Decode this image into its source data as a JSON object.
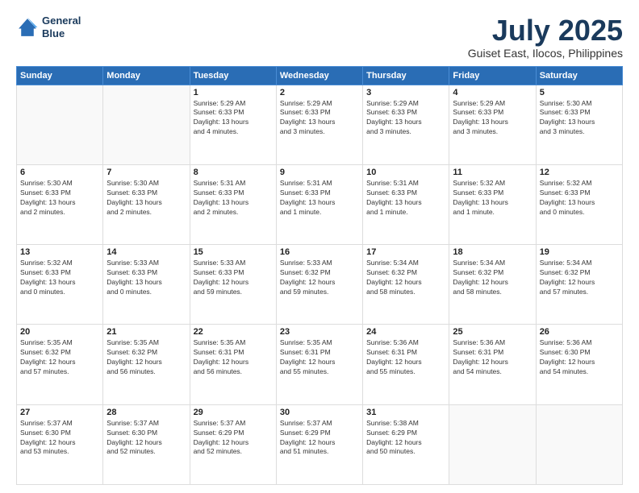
{
  "logo": {
    "line1": "General",
    "line2": "Blue"
  },
  "title": "July 2025",
  "subtitle": "Guiset East, Ilocos, Philippines",
  "weekdays": [
    "Sunday",
    "Monday",
    "Tuesday",
    "Wednesday",
    "Thursday",
    "Friday",
    "Saturday"
  ],
  "weeks": [
    [
      {
        "day": "",
        "info": ""
      },
      {
        "day": "",
        "info": ""
      },
      {
        "day": "1",
        "info": "Sunrise: 5:29 AM\nSunset: 6:33 PM\nDaylight: 13 hours\nand 4 minutes."
      },
      {
        "day": "2",
        "info": "Sunrise: 5:29 AM\nSunset: 6:33 PM\nDaylight: 13 hours\nand 3 minutes."
      },
      {
        "day": "3",
        "info": "Sunrise: 5:29 AM\nSunset: 6:33 PM\nDaylight: 13 hours\nand 3 minutes."
      },
      {
        "day": "4",
        "info": "Sunrise: 5:29 AM\nSunset: 6:33 PM\nDaylight: 13 hours\nand 3 minutes."
      },
      {
        "day": "5",
        "info": "Sunrise: 5:30 AM\nSunset: 6:33 PM\nDaylight: 13 hours\nand 3 minutes."
      }
    ],
    [
      {
        "day": "6",
        "info": "Sunrise: 5:30 AM\nSunset: 6:33 PM\nDaylight: 13 hours\nand 2 minutes."
      },
      {
        "day": "7",
        "info": "Sunrise: 5:30 AM\nSunset: 6:33 PM\nDaylight: 13 hours\nand 2 minutes."
      },
      {
        "day": "8",
        "info": "Sunrise: 5:31 AM\nSunset: 6:33 PM\nDaylight: 13 hours\nand 2 minutes."
      },
      {
        "day": "9",
        "info": "Sunrise: 5:31 AM\nSunset: 6:33 PM\nDaylight: 13 hours\nand 1 minute."
      },
      {
        "day": "10",
        "info": "Sunrise: 5:31 AM\nSunset: 6:33 PM\nDaylight: 13 hours\nand 1 minute."
      },
      {
        "day": "11",
        "info": "Sunrise: 5:32 AM\nSunset: 6:33 PM\nDaylight: 13 hours\nand 1 minute."
      },
      {
        "day": "12",
        "info": "Sunrise: 5:32 AM\nSunset: 6:33 PM\nDaylight: 13 hours\nand 0 minutes."
      }
    ],
    [
      {
        "day": "13",
        "info": "Sunrise: 5:32 AM\nSunset: 6:33 PM\nDaylight: 13 hours\nand 0 minutes."
      },
      {
        "day": "14",
        "info": "Sunrise: 5:33 AM\nSunset: 6:33 PM\nDaylight: 13 hours\nand 0 minutes."
      },
      {
        "day": "15",
        "info": "Sunrise: 5:33 AM\nSunset: 6:33 PM\nDaylight: 12 hours\nand 59 minutes."
      },
      {
        "day": "16",
        "info": "Sunrise: 5:33 AM\nSunset: 6:32 PM\nDaylight: 12 hours\nand 59 minutes."
      },
      {
        "day": "17",
        "info": "Sunrise: 5:34 AM\nSunset: 6:32 PM\nDaylight: 12 hours\nand 58 minutes."
      },
      {
        "day": "18",
        "info": "Sunrise: 5:34 AM\nSunset: 6:32 PM\nDaylight: 12 hours\nand 58 minutes."
      },
      {
        "day": "19",
        "info": "Sunrise: 5:34 AM\nSunset: 6:32 PM\nDaylight: 12 hours\nand 57 minutes."
      }
    ],
    [
      {
        "day": "20",
        "info": "Sunrise: 5:35 AM\nSunset: 6:32 PM\nDaylight: 12 hours\nand 57 minutes."
      },
      {
        "day": "21",
        "info": "Sunrise: 5:35 AM\nSunset: 6:32 PM\nDaylight: 12 hours\nand 56 minutes."
      },
      {
        "day": "22",
        "info": "Sunrise: 5:35 AM\nSunset: 6:31 PM\nDaylight: 12 hours\nand 56 minutes."
      },
      {
        "day": "23",
        "info": "Sunrise: 5:35 AM\nSunset: 6:31 PM\nDaylight: 12 hours\nand 55 minutes."
      },
      {
        "day": "24",
        "info": "Sunrise: 5:36 AM\nSunset: 6:31 PM\nDaylight: 12 hours\nand 55 minutes."
      },
      {
        "day": "25",
        "info": "Sunrise: 5:36 AM\nSunset: 6:31 PM\nDaylight: 12 hours\nand 54 minutes."
      },
      {
        "day": "26",
        "info": "Sunrise: 5:36 AM\nSunset: 6:30 PM\nDaylight: 12 hours\nand 54 minutes."
      }
    ],
    [
      {
        "day": "27",
        "info": "Sunrise: 5:37 AM\nSunset: 6:30 PM\nDaylight: 12 hours\nand 53 minutes."
      },
      {
        "day": "28",
        "info": "Sunrise: 5:37 AM\nSunset: 6:30 PM\nDaylight: 12 hours\nand 52 minutes."
      },
      {
        "day": "29",
        "info": "Sunrise: 5:37 AM\nSunset: 6:29 PM\nDaylight: 12 hours\nand 52 minutes."
      },
      {
        "day": "30",
        "info": "Sunrise: 5:37 AM\nSunset: 6:29 PM\nDaylight: 12 hours\nand 51 minutes."
      },
      {
        "day": "31",
        "info": "Sunrise: 5:38 AM\nSunset: 6:29 PM\nDaylight: 12 hours\nand 50 minutes."
      },
      {
        "day": "",
        "info": ""
      },
      {
        "day": "",
        "info": ""
      }
    ]
  ]
}
